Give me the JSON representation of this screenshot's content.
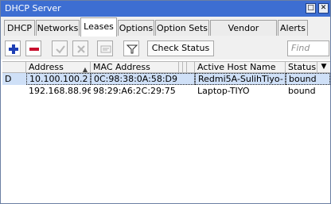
{
  "window": {
    "title": "DHCP Server"
  },
  "tabs": [
    {
      "label": "DHCP",
      "active": false
    },
    {
      "label": "Networks",
      "active": false
    },
    {
      "label": "Leases",
      "active": true
    },
    {
      "label": "Options",
      "active": false
    },
    {
      "label": "Option Sets",
      "active": false
    },
    {
      "label": "Vendor Classes",
      "active": false
    },
    {
      "label": "Alerts",
      "active": false
    }
  ],
  "toolbar": {
    "icons": [
      "add-icon",
      "remove-icon",
      "enable-icon",
      "disable-icon",
      "comment-icon",
      "filter-icon"
    ],
    "check_status_label": "Check Status",
    "find_placeholder": "Find"
  },
  "table": {
    "columns": [
      "",
      "Address",
      "MAC Address",
      "",
      "",
      "",
      "Active Host Name",
      "Status"
    ],
    "sorted_column": "Address",
    "rows": [
      {
        "flag": "D",
        "address": "10.100.100.2",
        "mac": "0C:98:38:0A:58:D9",
        "host": "Redmi5A-SulihTiyo-",
        "status": "bound",
        "selected": true
      },
      {
        "flag": "",
        "address": "192.168.88.96",
        "mac": "98:29:A6:2C:29:75",
        "host": "Laptop-TIYO",
        "status": "bound",
        "selected": false
      }
    ]
  },
  "colors": {
    "titlebar": "#3d6ed2",
    "selection": "#cfe0f7",
    "add": "#1f3fb5",
    "remove": "#c8102e"
  }
}
